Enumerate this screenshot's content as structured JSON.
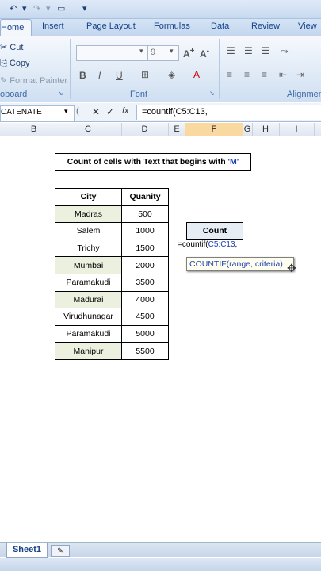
{
  "quick_access": {
    "undo_icon": "↶",
    "redo_icon": "↷",
    "more_icon": "▾"
  },
  "tabs": [
    "Home",
    "Insert",
    "Page Layout",
    "Formulas",
    "Data",
    "Review",
    "View"
  ],
  "ribbon": {
    "clipboard": {
      "cut": "Cut",
      "copy": "Copy",
      "format_painter": "Format Painter",
      "title": "oboard"
    },
    "font": {
      "size": "9",
      "bold": "B",
      "italic": "I",
      "underline": "U",
      "title": "Font"
    },
    "alignment": {
      "title": "Alignmen"
    }
  },
  "formula_bar": {
    "name_box": "CATENATE",
    "cancel": "✕",
    "enter": "✓",
    "fx": "fx",
    "formula": "=countif(C5:C13,"
  },
  "columns": [
    "B",
    "C",
    "D",
    "E",
    "F",
    "G",
    "H",
    "I"
  ],
  "sheet": {
    "title_text": "Count of cells with Text that begins with ",
    "title_highlight": "'M'",
    "table_headers": {
      "city": "City",
      "quantity": "Quanity"
    },
    "rows": [
      {
        "city": "Madras",
        "qty": "500"
      },
      {
        "city": "Salem",
        "qty": "1000"
      },
      {
        "city": "Trichy",
        "qty": "1500"
      },
      {
        "city": "Mumbai",
        "qty": "2000"
      },
      {
        "city": "Paramakudi",
        "qty": "3500"
      },
      {
        "city": "Madurai",
        "qty": "4000"
      },
      {
        "city": "Virudhunagar",
        "qty": "4500"
      },
      {
        "city": "Paramakudi",
        "qty": "5000"
      },
      {
        "city": "Manipur",
        "qty": "5500"
      }
    ],
    "count_label": "Count",
    "count_formula_prefix": "=countif(",
    "count_formula_ref": "C5:C13",
    "count_formula_suffix": ",",
    "tooltip": "COUNTIF(range, criteria)"
  },
  "sheet_tabs": {
    "active": "Sheet1"
  }
}
